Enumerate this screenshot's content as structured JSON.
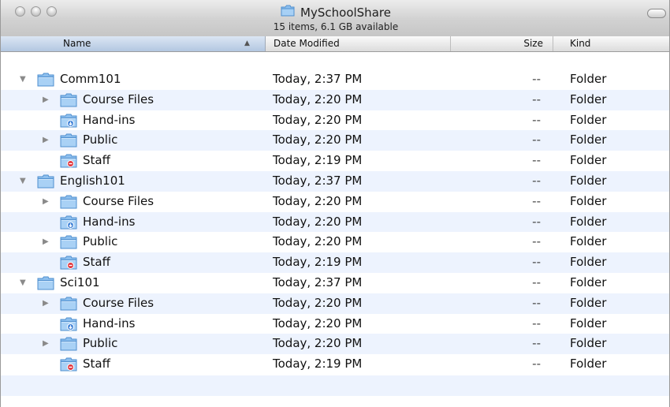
{
  "window": {
    "title": "MySchoolShare",
    "status_text": "15 items, 6.1 GB available",
    "title_icon": "folder-icon"
  },
  "columns": {
    "name": "Name",
    "date": "Date Modified",
    "size": "Size",
    "kind": "Kind"
  },
  "rows": [
    {
      "name": "Comm101",
      "date": "Today, 2:37 PM",
      "size": "--",
      "kind": "Folder",
      "level": 0,
      "disclosure": "expanded",
      "icon": "folder-icon"
    },
    {
      "name": "Course Files",
      "date": "Today, 2:20 PM",
      "size": "--",
      "kind": "Folder",
      "level": 1,
      "disclosure": "collapsed",
      "icon": "folder-icon"
    },
    {
      "name": "Hand-ins",
      "date": "Today, 2:20 PM",
      "size": "--",
      "kind": "Folder",
      "level": 1,
      "disclosure": "none",
      "icon": "dropbox-folder-icon"
    },
    {
      "name": "Public",
      "date": "Today, 2:20 PM",
      "size": "--",
      "kind": "Folder",
      "level": 1,
      "disclosure": "collapsed",
      "icon": "folder-icon"
    },
    {
      "name": "Staff",
      "date": "Today, 2:19 PM",
      "size": "--",
      "kind": "Folder",
      "level": 1,
      "disclosure": "none",
      "icon": "restricted-folder-icon"
    },
    {
      "name": "English101",
      "date": "Today, 2:37 PM",
      "size": "--",
      "kind": "Folder",
      "level": 0,
      "disclosure": "expanded",
      "icon": "folder-icon"
    },
    {
      "name": "Course Files",
      "date": "Today, 2:20 PM",
      "size": "--",
      "kind": "Folder",
      "level": 1,
      "disclosure": "collapsed",
      "icon": "folder-icon"
    },
    {
      "name": "Hand-ins",
      "date": "Today, 2:20 PM",
      "size": "--",
      "kind": "Folder",
      "level": 1,
      "disclosure": "none",
      "icon": "dropbox-folder-icon"
    },
    {
      "name": "Public",
      "date": "Today, 2:20 PM",
      "size": "--",
      "kind": "Folder",
      "level": 1,
      "disclosure": "collapsed",
      "icon": "folder-icon"
    },
    {
      "name": "Staff",
      "date": "Today, 2:19 PM",
      "size": "--",
      "kind": "Folder",
      "level": 1,
      "disclosure": "none",
      "icon": "restricted-folder-icon"
    },
    {
      "name": "Sci101",
      "date": "Today, 2:37 PM",
      "size": "--",
      "kind": "Folder",
      "level": 0,
      "disclosure": "expanded",
      "icon": "folder-icon"
    },
    {
      "name": "Course Files",
      "date": "Today, 2:20 PM",
      "size": "--",
      "kind": "Folder",
      "level": 1,
      "disclosure": "collapsed",
      "icon": "folder-icon"
    },
    {
      "name": "Hand-ins",
      "date": "Today, 2:20 PM",
      "size": "--",
      "kind": "Folder",
      "level": 1,
      "disclosure": "none",
      "icon": "dropbox-folder-icon"
    },
    {
      "name": "Public",
      "date": "Today, 2:20 PM",
      "size": "--",
      "kind": "Folder",
      "level": 1,
      "disclosure": "collapsed",
      "icon": "folder-icon"
    },
    {
      "name": "Staff",
      "date": "Today, 2:19 PM",
      "size": "--",
      "kind": "Folder",
      "level": 1,
      "disclosure": "none",
      "icon": "restricted-folder-icon"
    }
  ],
  "colors": {
    "folder": "#7fb6e8",
    "folder_dark": "#4f8fcf",
    "row_alt": "#edf3fe",
    "sorted_header": "#b3c7e1"
  }
}
